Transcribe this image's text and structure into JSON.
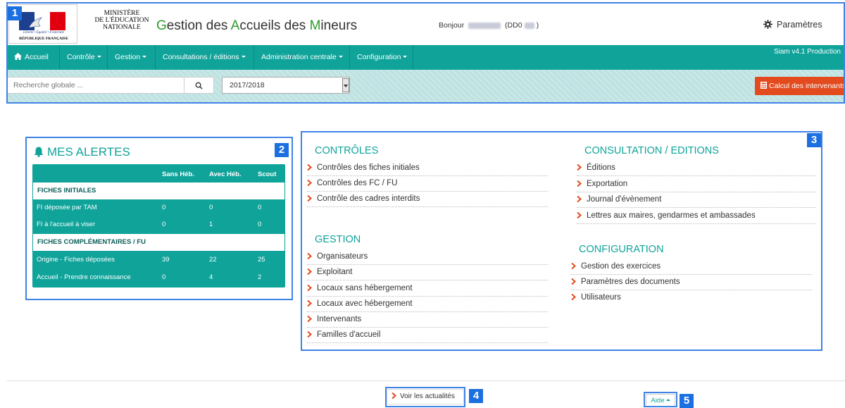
{
  "header": {
    "motto": "Liberté • Égalité • Fraternité",
    "republic": "RÉPUBLIQUE FRANÇAISE",
    "ministry_line1": "MINISTÈRE",
    "ministry_line2": "DE L'ÉDUCATION",
    "ministry_line3": "NATIONALE",
    "title_g": "G",
    "title_part1": "estion des ",
    "title_a": "A",
    "title_part2": "ccueils des ",
    "title_m": "M",
    "title_part3": "ineurs",
    "greeting_prefix": "Bonjour",
    "greeting_code_prefix": "(DD0",
    "greeting_code_suffix": ")",
    "settings_label": "Paramètres"
  },
  "nav": {
    "items": [
      "Accueil",
      "Contrôle",
      "Gestion",
      "Consultations / éditions",
      "Administration centrale",
      "Configuration"
    ],
    "version": "Siam v4.1 Production"
  },
  "search": {
    "placeholder": "Recherche globale ...",
    "year": "2017/2018",
    "calc_button": "Calcul des intervenants"
  },
  "badges": [
    "1",
    "2",
    "3",
    "4",
    "5"
  ],
  "alerts": {
    "title": "MES ALERTES",
    "columns": [
      "Sans Héb.",
      "Avec Héb.",
      "Scout"
    ],
    "sections": [
      {
        "name": "FICHES INITIALES",
        "rows": [
          {
            "label": "FI déposée par TAM",
            "values": [
              "0",
              "0",
              "0"
            ]
          },
          {
            "label": "FI à l'accueil à viser",
            "values": [
              "0",
              "1",
              "0"
            ]
          }
        ]
      },
      {
        "name": "FICHES COMPLÉMENTAIRES / FU",
        "rows": [
          {
            "label": "Origine - Fiches déposées",
            "values": [
              "39",
              "22",
              "25"
            ]
          },
          {
            "label": "Accueil - Prendre connaissance",
            "values": [
              "0",
              "4",
              "2"
            ]
          }
        ]
      }
    ]
  },
  "panel": {
    "controles": {
      "title": "CONTRÔLES",
      "links": [
        "Contrôles des fiches initiales",
        "Contrôles des FC / FU",
        "Contrôle des cadres interdits"
      ]
    },
    "gestion": {
      "title": "GESTION",
      "links": [
        "Organisateurs",
        "Exploitant",
        "Locaux sans hébergement",
        "Locaux avec hébergement",
        "Intervenants",
        "Familles d'accueil"
      ]
    },
    "consultation": {
      "title": "CONSULTATION / EDITIONS",
      "links": [
        "Éditions",
        "Exportation",
        "Journal d'évènement",
        "Lettres aux maires, gendarmes et ambassades"
      ]
    },
    "configuration": {
      "title": "CONFIGURATION",
      "links": [
        "Gestion des exercices",
        "Paramètres des documents",
        "Utilisateurs"
      ]
    }
  },
  "footer": {
    "news": "Voir les actualités",
    "help": "Aide"
  },
  "colors": {
    "teal": "#0fa39a",
    "orange": "#e34a1d",
    "callout_blue": "#3f83e6",
    "chevron": "#e34a1d"
  }
}
